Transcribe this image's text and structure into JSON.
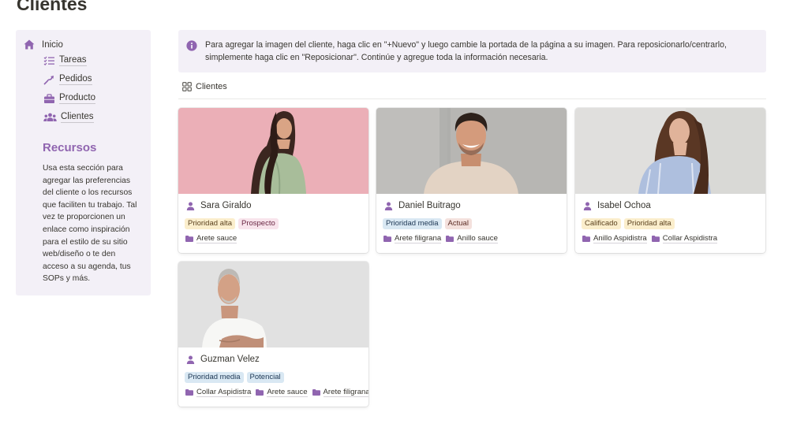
{
  "page": {
    "title": "Clientes"
  },
  "sidebar": {
    "home": {
      "label": "Inicio",
      "icon": "house-icon"
    },
    "items": [
      {
        "label": "Tareas",
        "icon": "checklist-icon"
      },
      {
        "label": "Pedidos",
        "icon": "trend-arrow-icon"
      },
      {
        "label": "Producto",
        "icon": "briefcase-icon"
      },
      {
        "label": "Clientes",
        "icon": "people-icon"
      }
    ],
    "section_title": "Recursos",
    "section_text": "Usa esta sección para agregar las preferencias del cliente o los recursos que faciliten tu trabajo. Tal vez te proporcionen un enlace como inspiración para el estilo de su sitio web/diseño o te den acceso a su agenda, tus SOPs y más."
  },
  "callout": {
    "text": "Para agregar la imagen del cliente, haga clic en \"+Nuevo\" y luego cambie la portada de la página a su imagen. Para reposicionarlo/centrarlo, simplemente haga clic en \"Reposicionar\". Continúe y agregue toda la información necesaria."
  },
  "view": {
    "label": "Clientes",
    "icon": "gallery-icon"
  },
  "colors": {
    "accent": "#9065b0",
    "sidebar_bg": "#f3f0f7"
  },
  "cards": [
    {
      "name": "Sara Giraldo",
      "tags": [
        {
          "label": "Prioridad alta",
          "bg": "#fbeecc",
          "fg": "#5c4320"
        },
        {
          "label": "Prospecto",
          "bg": "#f8e4ec",
          "fg": "#6b2945"
        }
      ],
      "relations": [
        "Arete sauce"
      ]
    },
    {
      "name": "Daniel Buitrago",
      "tags": [
        {
          "label": "Prioridad media",
          "bg": "#d9e8f3",
          "fg": "#203a57"
        },
        {
          "label": "Actual",
          "bg": "#f4e1dd",
          "fg": "#5d2e26"
        }
      ],
      "relations": [
        "Arete filigrana",
        "Anillo sauce"
      ]
    },
    {
      "name": "Isabel Ochoa",
      "tags": [
        {
          "label": "Calificado",
          "bg": "#fbeecc",
          "fg": "#5c4320"
        },
        {
          "label": "Prioridad alta",
          "bg": "#fbeecc",
          "fg": "#5c4320"
        }
      ],
      "relations": [
        "Anillo Aspidistra",
        "Collar Aspidistra"
      ]
    },
    {
      "name": "Guzman Velez",
      "tags": [
        {
          "label": "Prioridad media",
          "bg": "#d9e8f3",
          "fg": "#203a57"
        },
        {
          "label": "Potencial",
          "bg": "#d9e8f3",
          "fg": "#203a57"
        }
      ],
      "relations": [
        "Collar Aspidistra",
        "Arete sauce",
        "Arete filigrana"
      ]
    }
  ]
}
